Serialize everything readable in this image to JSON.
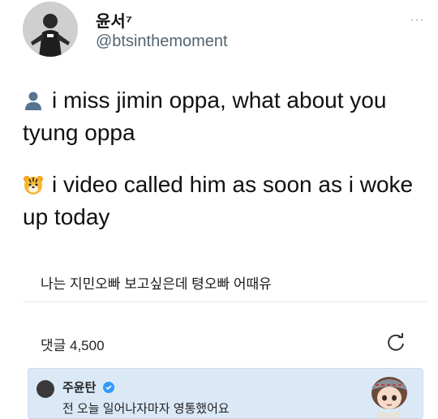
{
  "author": {
    "display_name": "윤서⁷",
    "handle": "@btsinthemoment"
  },
  "more_icon": "···",
  "tweet": {
    "line1_icon": "bust-in-silhouette-icon",
    "line1_text": "i miss jimin oppa, what about you tyung oppa",
    "line2_icon": "tiger-face-icon",
    "line2_text": "i video called him as soon as i woke up today"
  },
  "screenshot": {
    "title": "나는 지민오빠 보고싶은데 텽오빠 어때유",
    "comments_label": "댓글 4,500",
    "reply": {
      "name": "주윤탄",
      "text": "전 오늘 일어나자마자 영통했어요"
    }
  }
}
